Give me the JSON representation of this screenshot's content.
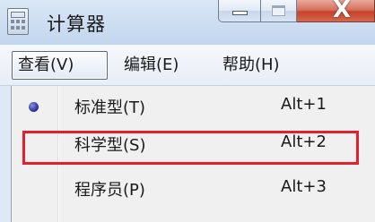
{
  "window": {
    "title": "计算器",
    "controls": {
      "minimize": "minimize",
      "maximize": "maximize",
      "close_glyph": "X"
    }
  },
  "menubar": {
    "items": [
      {
        "label": "查看(V)",
        "active": true
      },
      {
        "label": "编辑(E)",
        "active": false
      },
      {
        "label": "帮助(H)",
        "active": false
      }
    ]
  },
  "dropdown": {
    "items": [
      {
        "label": "标准型(T)",
        "shortcut": "Alt+1",
        "checked": true,
        "highlighted": false
      },
      {
        "label": "科学型(S)",
        "shortcut": "Alt+2",
        "checked": false,
        "highlighted": true
      },
      {
        "label": "程序员(P)",
        "shortcut": "Alt+3",
        "checked": false,
        "highlighted": false
      }
    ]
  },
  "colors": {
    "highlight_border": "#e3212e",
    "radio_dot": "#2d37a3",
    "close_button": "#c4432b"
  }
}
